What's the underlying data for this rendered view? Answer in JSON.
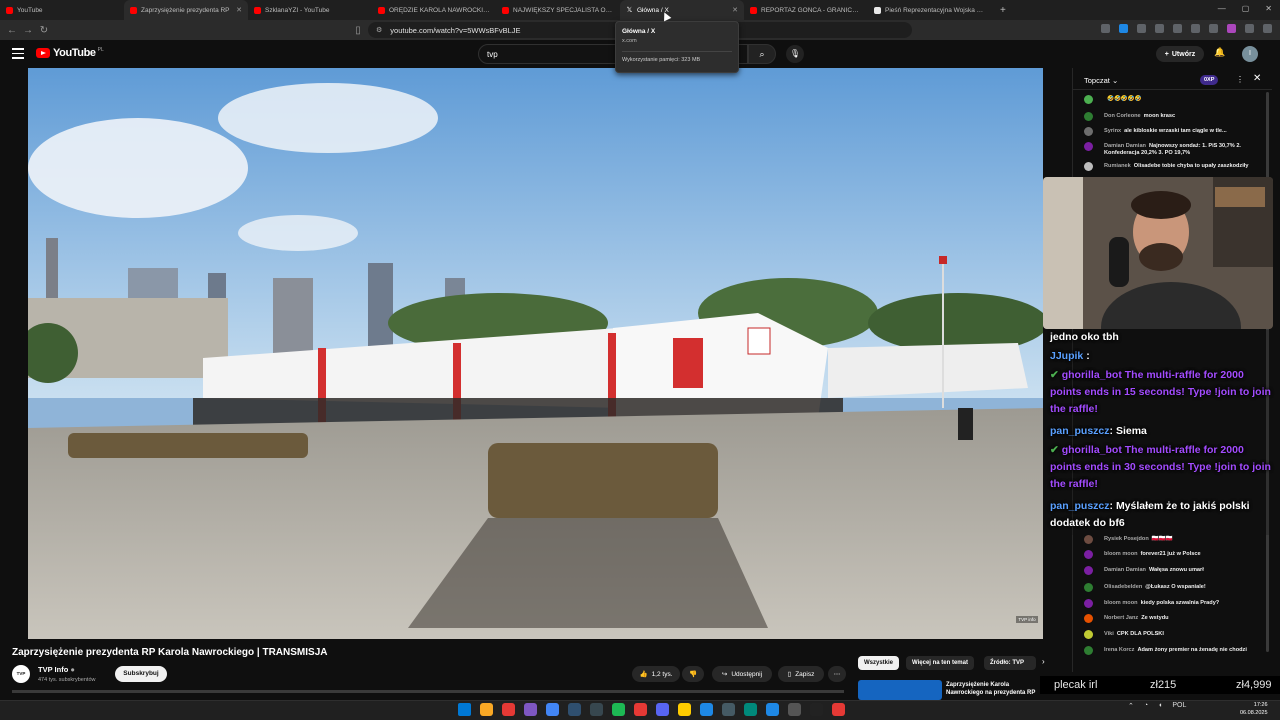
{
  "browser": {
    "tabs": [
      {
        "label": "YouTube",
        "favicon": "youtube-icon",
        "active": false
      },
      {
        "label": "Zaprzysiężenie prezydenta RP",
        "favicon": "youtube-icon",
        "active": false
      },
      {
        "label": "SzklanaYZI - YouTube",
        "favicon": "youtube-icon",
        "active": false
      },
      {
        "label": "ORĘDZIE KAROLA NAWROCKIEGO",
        "favicon": "youtube-icon",
        "active": false
      },
      {
        "label": "NAJWIĘKSZY SPECJALISTA OD AI W",
        "favicon": "youtube-icon",
        "active": false
      },
      {
        "label": "Główna / X",
        "favicon": "x-icon",
        "active": true
      },
      {
        "label": "REPORTAŻ GOŃCA - GRANICA FAŁSZ",
        "favicon": "youtube-icon",
        "active": false
      },
      {
        "label": "Pieśń Reprezentacyjna Wojska Polskiego",
        "favicon": "wiki-icon",
        "active": false
      }
    ],
    "url": "youtube.com/watch?v=5WWsBFvBLJE",
    "tooltip": {
      "title": "Główna / X",
      "url": "x.com",
      "memory": "Wykorzystanie pamięci: 323 MB"
    }
  },
  "youtube": {
    "logo_text": "YouTube",
    "logo_region": "PL",
    "search_value": "tvp",
    "create_label": "Utwórz",
    "avatar_letter": "I"
  },
  "video": {
    "title": "Zaprzysiężenie prezydenta RP Karola Nawrockiego | TRANSMISJA",
    "channel": "TVP Info",
    "channel_avatar": "TVP Info",
    "subscribers": "474 tys. subskrybentów",
    "subscribe_label": "Subskrybuj",
    "likes": "1,2 tys.",
    "share_label": "Udostępnij",
    "save_label": "Zapisz",
    "watermark": "TVP info"
  },
  "chips": [
    "Wszystkie",
    "Więcej na ten temat",
    "Źródło: TVP"
  ],
  "recommendation": {
    "title": "Zaprzysiężenie Karola Nawrockiego na prezydenta RP"
  },
  "chat": {
    "header": "Topczat",
    "xp_badge": "0XP",
    "messages": [
      {
        "author": "",
        "text": "🤣🤣🤣🤣🤣",
        "color": "#4caf50"
      },
      {
        "author": "Don Corleone",
        "text": "moon krasc",
        "color": "#2e7d32"
      },
      {
        "author": "Syrinx",
        "text": "ale kibloskie wrzaski tam ciągle w tle...",
        "color": "#6d6d6d"
      },
      {
        "author": "Damian Damian",
        "text": "Najnowszy sondaż: 1. PiS 30,7% 2. Konfederacja 20,2% 3. PO 19,7%",
        "color": "#7b1fa2"
      },
      {
        "author": "Rumianek",
        "text": "Olisadebe tobie chyba to upały zaszkodziły",
        "color": "#bdbdbd"
      },
      {
        "author": "Rysiek Posejdon",
        "text": "🇵🇱🇵🇱🇵🇱",
        "color": "#6d4c41"
      },
      {
        "author": "bloom moon",
        "text": "forever21 już w Polsce",
        "color": "#7b1fa2"
      },
      {
        "author": "Damian Damian",
        "text": "Wałęsa znowu umarł",
        "color": "#7b1fa2"
      },
      {
        "author": "Olisadebelden",
        "text": "@Łukasz O wspaniale!",
        "color": "#2e7d32"
      },
      {
        "author": "bloom moon",
        "text": "kiedy polska szwalnia Prady?",
        "color": "#7b1fa2"
      },
      {
        "author": "Norbert Janz",
        "text": "Ze wstydu",
        "color": "#e65100"
      },
      {
        "author": "Viki",
        "text": "CPK DLA POLSKI",
        "color": "#c0ca33"
      },
      {
        "author": "Irena Korcz",
        "text": "Adam żony premier na żenadę nie chodzi",
        "color": "#2e7d32"
      }
    ]
  },
  "overlay": {
    "lines": [
      {
        "user": "",
        "text": "jedno oko tbh",
        "kind": "plain"
      },
      {
        "user": "JJupik",
        "text": ":",
        "kind": "user"
      },
      {
        "user": "ghorilla_bot",
        "text": "The multi-raffle for 2000 points ends in 15 seconds! Type !join to join the raffle!",
        "kind": "bot"
      },
      {
        "user": "pan_puszcz",
        "text": "Siema",
        "kind": "user"
      },
      {
        "user": "ghorilla_bot",
        "text": "The multi-raffle for 2000 points ends in 30 seconds! Type !join to join the raffle!",
        "kind": "bot"
      },
      {
        "user": "pan_puszcz",
        "text": "Myślałem że to jakiś polski dodatek do bf6",
        "kind": "user"
      }
    ],
    "bar_left": "plecak irl",
    "bar_mid": "zł215",
    "bar_right": "zł4,999"
  },
  "taskbar": {
    "language": "POL",
    "time": "17:26",
    "date": "06.08.2025"
  },
  "colors": {
    "accent": "#ff0000",
    "bot": "#a34cff",
    "user": "#5aa0ff"
  }
}
